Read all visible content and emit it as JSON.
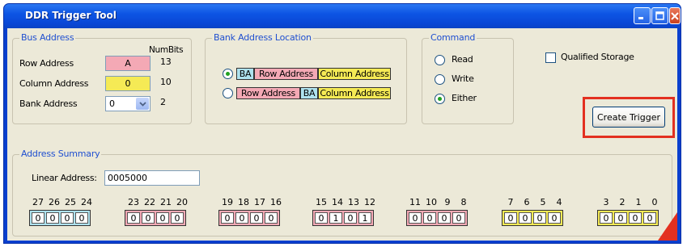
{
  "window": {
    "title": "DDR Trigger Tool"
  },
  "bus_address": {
    "title": "Bus Address",
    "numbits_header": "NumBits",
    "rows": [
      {
        "label": "Row Address",
        "value": "A",
        "numbits": "13",
        "color": "#f4a9b5"
      },
      {
        "label": "Column Address",
        "value": "0",
        "numbits": "10",
        "color": "#f5ea55"
      },
      {
        "label": "Bank Address",
        "value": "0",
        "numbits": "2",
        "color": "#ffffff"
      }
    ]
  },
  "bank_location": {
    "title": "Bank Address Location",
    "options": [
      {
        "selected": true,
        "segments": [
          "BA",
          "Row Address",
          "Column Address"
        ]
      },
      {
        "selected": false,
        "segments": [
          "Row Address",
          "BA",
          "Column Address"
        ]
      }
    ]
  },
  "command": {
    "title": "Command",
    "options": [
      {
        "label": "Read",
        "selected": false
      },
      {
        "label": "Write",
        "selected": false
      },
      {
        "label": "Either",
        "selected": true
      }
    ]
  },
  "qualified_storage": {
    "label": "Qualified Storage",
    "checked": false
  },
  "create_trigger": {
    "label": "Create Trigger"
  },
  "summary": {
    "title": "Address Summary",
    "linear_label": "Linear Address:",
    "linear_value": "0005000",
    "groups": [
      {
        "bits": [
          "27",
          "26",
          "25",
          "24"
        ],
        "values": [
          "0",
          "0",
          "0",
          "0"
        ],
        "color": "#aee2ee"
      },
      {
        "bits": [
          "23",
          "22",
          "21",
          "20"
        ],
        "values": [
          "0",
          "0",
          "0",
          "0"
        ],
        "color": "#f4a9b5"
      },
      {
        "bits": [
          "19",
          "18",
          "17",
          "16"
        ],
        "values": [
          "0",
          "0",
          "0",
          "0"
        ],
        "color": "#f4a9b5"
      },
      {
        "bits": [
          "15",
          "14",
          "13",
          "12"
        ],
        "values": [
          "0",
          "1",
          "0",
          "1"
        ],
        "color": "#f4a9b5"
      },
      {
        "bits": [
          "11",
          "10",
          "9",
          "8"
        ],
        "values": [
          "0",
          "0",
          "0",
          "0"
        ],
        "color": "#f4a9b5"
      },
      {
        "bits": [
          "7",
          "6",
          "5",
          "4"
        ],
        "values": [
          "0",
          "0",
          "0",
          "0"
        ],
        "color": "#f5ea55"
      },
      {
        "bits": [
          "3",
          "2",
          "1",
          "0"
        ],
        "values": [
          "0",
          "0",
          "0",
          "0"
        ],
        "color": "#f5ea55"
      }
    ]
  },
  "colors": {
    "highlight": "#e33020",
    "group_title": "#1f4fd0"
  }
}
